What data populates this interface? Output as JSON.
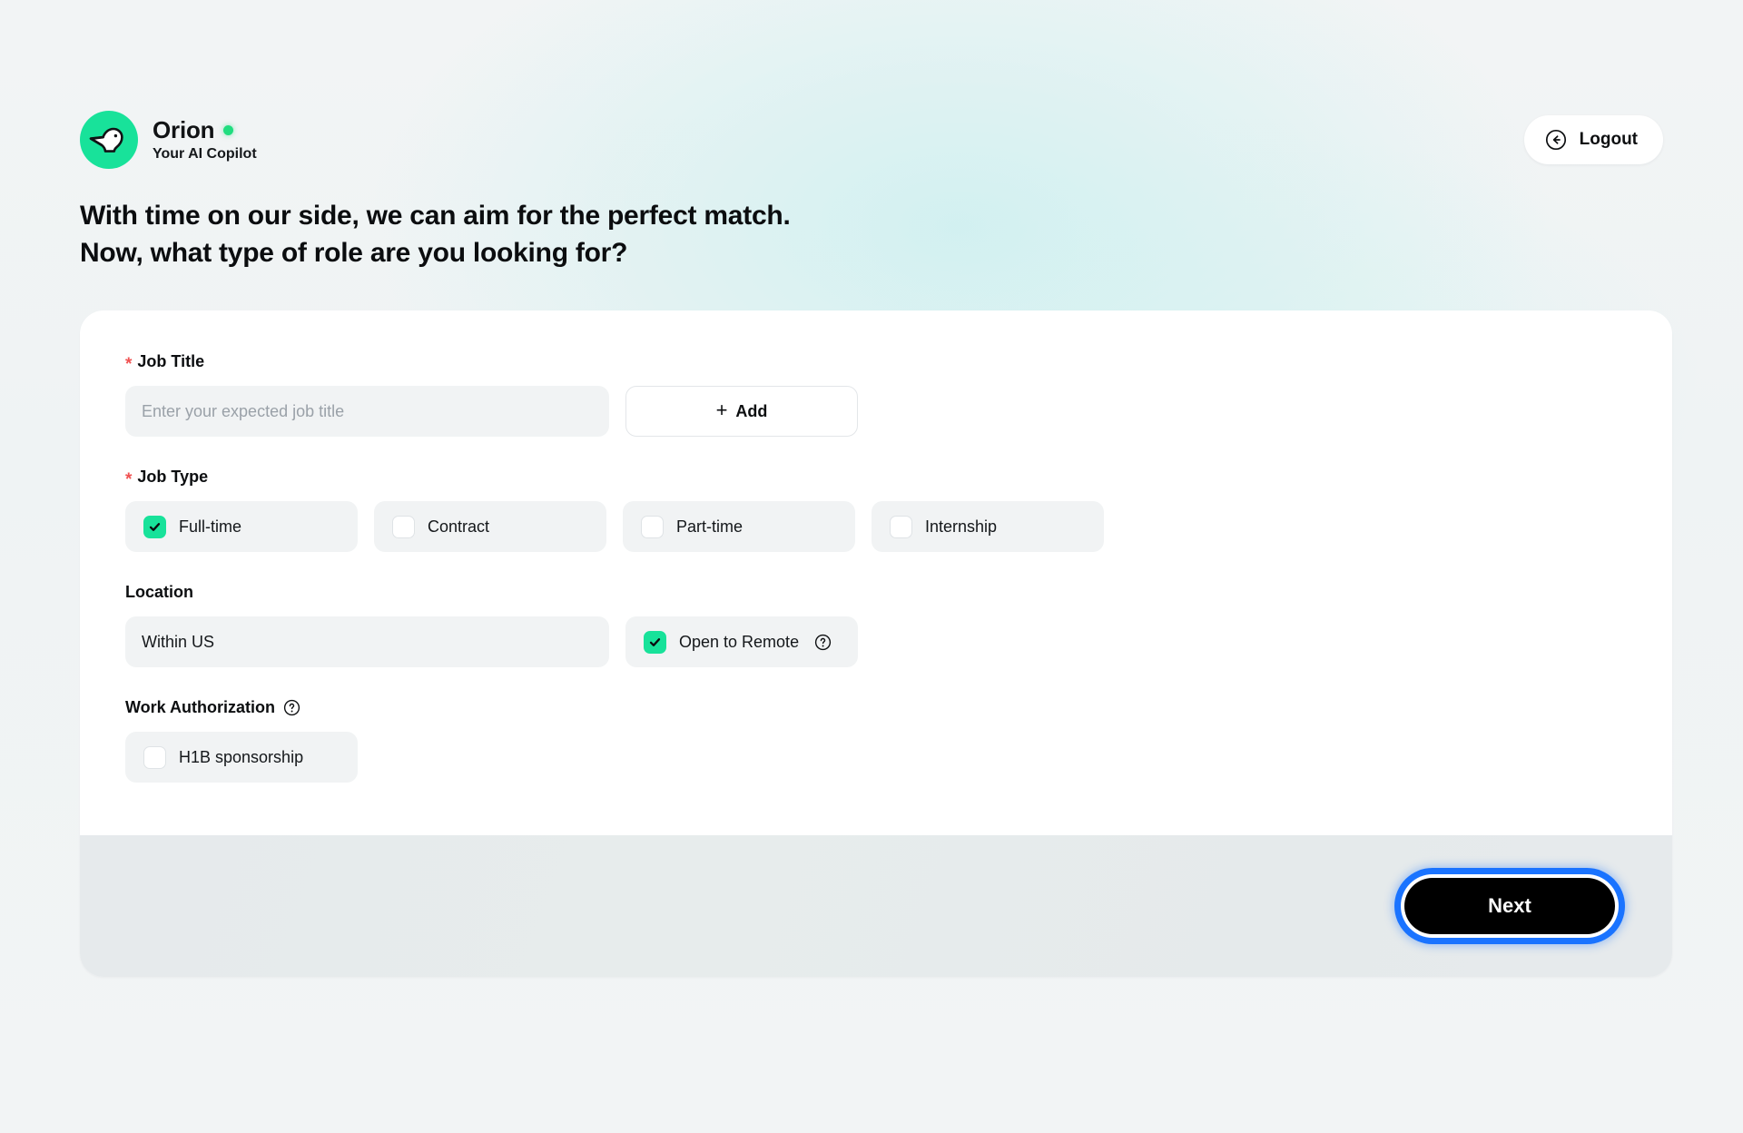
{
  "brand": {
    "name": "Orion",
    "subtitle": "Your AI Copilot",
    "logo_icon": "bird-logo-icon",
    "status_dot_color": "#20dd7f",
    "accent_color": "#18e29a"
  },
  "header": {
    "logout_label": "Logout",
    "logout_icon": "arrow-left-circle-icon"
  },
  "heading": {
    "line1": "With time on our side, we can aim for the perfect match.",
    "line2": "Now, what type of role are you looking for?"
  },
  "form": {
    "job_title": {
      "label": "Job Title",
      "required": true,
      "required_marker": "*",
      "input_value": "",
      "placeholder": "Enter your expected job title",
      "add_button_label": "Add",
      "add_button_icon": "plus-icon"
    },
    "job_type": {
      "label": "Job Type",
      "required": true,
      "required_marker": "*",
      "options": [
        {
          "label": "Full-time",
          "checked": true
        },
        {
          "label": "Contract",
          "checked": false
        },
        {
          "label": "Part-time",
          "checked": false
        },
        {
          "label": "Internship",
          "checked": false
        }
      ]
    },
    "location": {
      "label": "Location",
      "required": false,
      "value": "Within US",
      "remote": {
        "label": "Open to Remote",
        "checked": true,
        "help_icon": "question-circle-icon"
      }
    },
    "work_authorization": {
      "label": "Work Authorization",
      "required": false,
      "help_icon": "question-circle-icon",
      "options": [
        {
          "label": "H1B sponsorship",
          "checked": false
        }
      ]
    }
  },
  "footer": {
    "next_label": "Next",
    "focus_ring_color": "#1a73ff"
  }
}
